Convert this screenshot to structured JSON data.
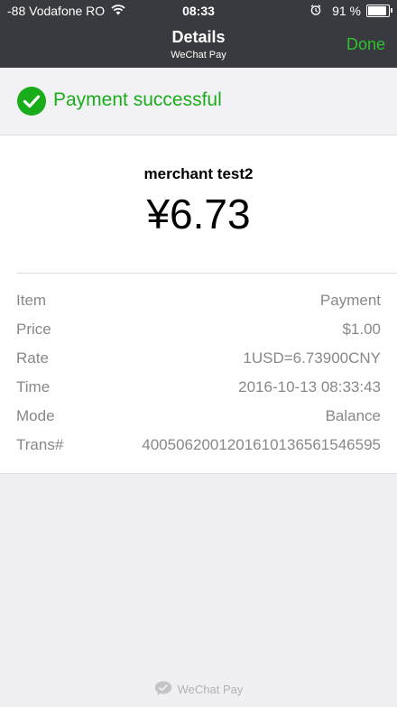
{
  "status_bar": {
    "carrier": "-88 Vodafone RO",
    "time": "08:33",
    "battery_percent_text": "91 %",
    "battery_level": 0.91,
    "icons": [
      "wifi-icon",
      "alarm-icon",
      "battery-icon"
    ]
  },
  "nav": {
    "title": "Details",
    "subtitle": "WeChat Pay",
    "done_label": "Done"
  },
  "success": {
    "icon": "checkmark-circle-icon",
    "text": "Payment successful"
  },
  "transaction": {
    "merchant": "merchant test2",
    "amount": "¥6.73",
    "rows": [
      {
        "label": "Item",
        "value": "Payment"
      },
      {
        "label": "Price",
        "value": "$1.00"
      },
      {
        "label": "Rate",
        "value": "1USD=6.73900CNY"
      },
      {
        "label": "Time",
        "value": "2016-10-13 08:33:43"
      },
      {
        "label": "Mode",
        "value": "Balance"
      },
      {
        "label": "Trans#",
        "value": "4005062001201610136561546595"
      }
    ]
  },
  "footer": {
    "icon": "wechat-pay-icon",
    "text": "WeChat Pay"
  },
  "colors": {
    "nav_bar": "#393a3f",
    "accent_green": "#1aad19",
    "done_green": "#2fc12d",
    "background": "#efeff4"
  }
}
